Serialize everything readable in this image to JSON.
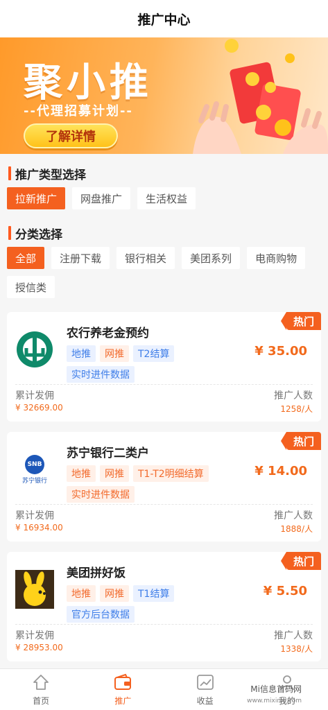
{
  "header": {
    "title": "推广中心"
  },
  "banner": {
    "headline": "聚小推",
    "subtitle": "--代理招募计划--",
    "cta": "了解详情"
  },
  "promo_type": {
    "title": "推广类型选择",
    "options": [
      "拉新推广",
      "网盘推广",
      "生活权益"
    ],
    "selected": "拉新推广"
  },
  "category": {
    "title": "分类选择",
    "options": [
      "全部",
      "注册下载",
      "银行相关",
      "美团系列",
      "电商购物",
      "授信类"
    ],
    "selected": "全部"
  },
  "cards": [
    {
      "badge": "热门",
      "name": "农行养老金预约",
      "tags": [
        "地推",
        "网推",
        "T2结算",
        "实时进件数据"
      ],
      "price": "¥ 35.00",
      "commission_label": "累计发佣",
      "commission_value": "¥ 32669.00",
      "people_label": "推广人数",
      "people_value": "1258/人"
    },
    {
      "badge": "热门",
      "name": "苏宁银行二类户",
      "tags": [
        "地推",
        "网推",
        "T1-T2明细结算",
        "实时进件数据"
      ],
      "price": "¥ 14.00",
      "commission_label": "累计发佣",
      "commission_value": "¥ 16934.00",
      "people_label": "推广人数",
      "people_value": "1888/人",
      "logo_text": "SNB",
      "logo_caption": "苏宁银行"
    },
    {
      "badge": "热门",
      "name": "美团拼好饭",
      "tags": [
        "地推",
        "网推",
        "T1结算",
        "官方后台数据"
      ],
      "price": "¥ 5.50",
      "commission_label": "累计发佣",
      "commission_value": "¥ 28953.00",
      "people_label": "推广人数",
      "people_value": "1338/人"
    }
  ],
  "tabbar": {
    "items": [
      {
        "label": "首页",
        "icon": "home-icon"
      },
      {
        "label": "推广",
        "icon": "wallet-icon"
      },
      {
        "label": "收益",
        "icon": "chart-icon"
      },
      {
        "label": "我的",
        "icon": "user-icon"
      }
    ],
    "active": "推广"
  },
  "watermark": {
    "line1": "Mi信息首码网",
    "line2": "www.mixinxi.com"
  },
  "colors": {
    "accent": "#f4601f",
    "price": "#f26a1c",
    "tag_blue": "#3f7ee8",
    "tag_orange": "#f26a2c"
  }
}
